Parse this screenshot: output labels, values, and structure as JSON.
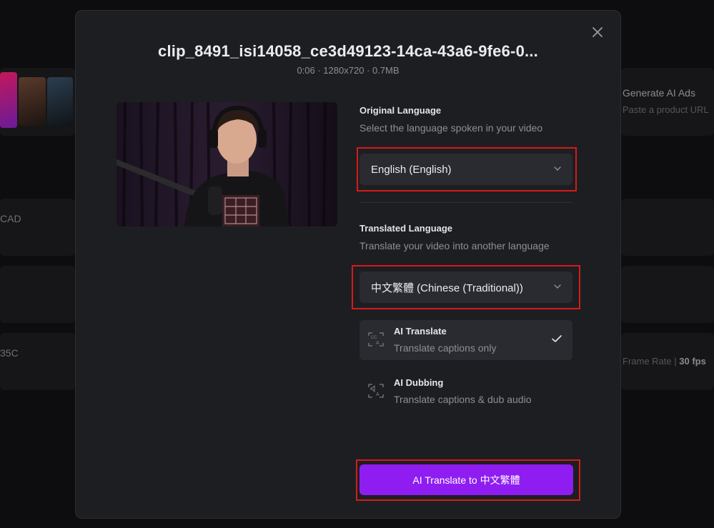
{
  "background": {
    "ads_title": "Generate AI Ads",
    "ads_sub": "Paste a product URL",
    "cad_text": "CAD",
    "code_text": "35C",
    "frame_rate_label": "Frame Rate |",
    "frame_rate_value": "30 fps"
  },
  "modal": {
    "title": "clip_8491_isi14058_ce3d49123-14ca-43a6-9fe6-0...",
    "meta": "0:06 · 1280x720 · 0.7MB",
    "close_icon": "close-icon",
    "original": {
      "label": "Original Language",
      "help": "Select the language spoken in your video",
      "value": "English (English)"
    },
    "translated": {
      "label": "Translated Language",
      "help": "Translate your video into another language",
      "value": "中文繁體 (Chinese (Traditional))"
    },
    "options": [
      {
        "title": "AI Translate",
        "subtitle": "Translate captions only",
        "selected": true,
        "icon": "captions-translate-icon"
      },
      {
        "title": "AI Dubbing",
        "subtitle": "Translate captions & dub audio",
        "selected": false,
        "icon": "audio-translate-icon"
      }
    ],
    "primary_label": "AI Translate to 中文繁體"
  },
  "colors": {
    "accent": "#8f1df2",
    "highlight": "#d61a1a",
    "modal_bg": "#1d1e22"
  }
}
